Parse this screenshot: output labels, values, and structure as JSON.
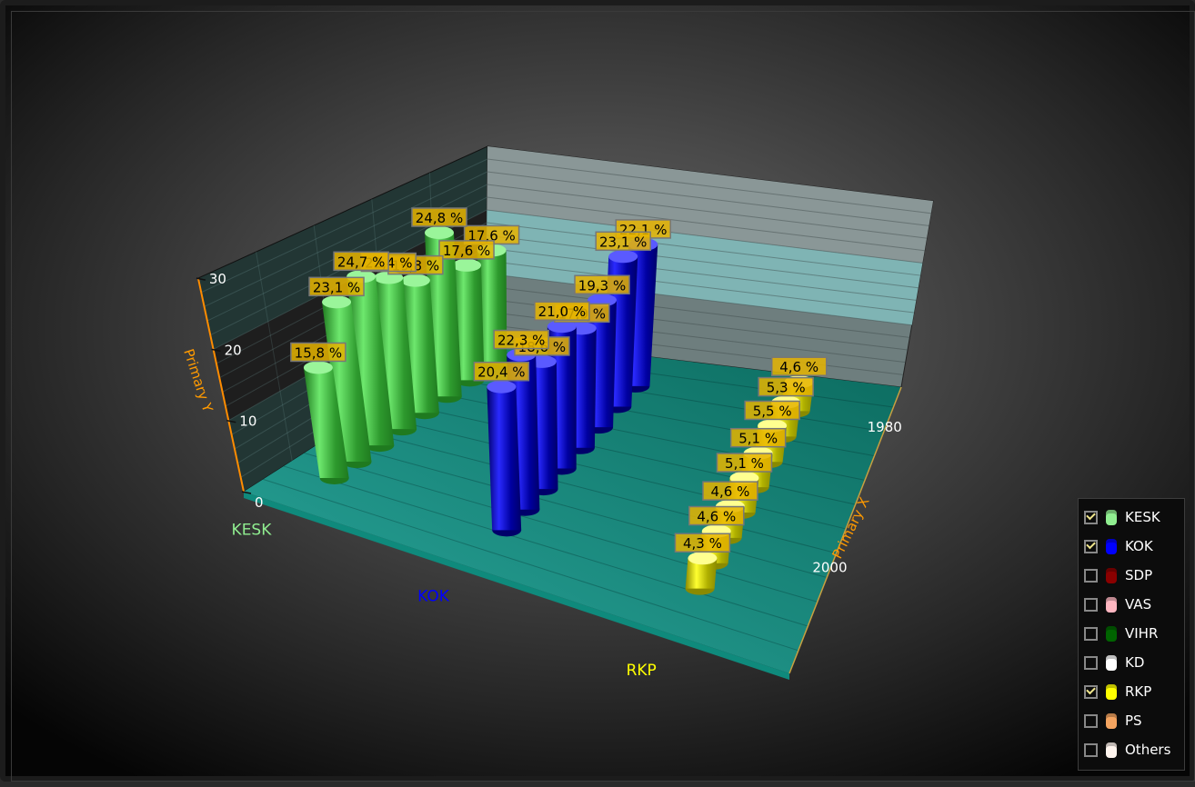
{
  "chart_data": {
    "type": "bar3d",
    "categories": [
      "KESK",
      "KOK",
      "RKP"
    ],
    "x": [
      1983,
      1987,
      1991,
      1995,
      1999,
      2003,
      2007,
      2011
    ],
    "series": [
      {
        "name": "KESK",
        "color": "#4fd04f",
        "values": [
          17.6,
          17.6,
          24.8,
          19.8,
          22.4,
          24.7,
          23.1,
          15.8
        ]
      },
      {
        "name": "KOK",
        "color": "#0a0ae0",
        "values": [
          22.1,
          23.1,
          19.3,
          17.9,
          21.0,
          18.6,
          22.3,
          20.4
        ]
      },
      {
        "name": "RKP",
        "color": "#e8e800",
        "values": [
          4.6,
          5.3,
          5.5,
          5.1,
          5.1,
          4.6,
          4.6,
          4.3
        ]
      }
    ],
    "data_label_suffix": " %",
    "xlabel": "Primary X",
    "ylabel": "Primary Y",
    "ylim": [
      0,
      30
    ],
    "yticks": [
      "0",
      "10",
      "20",
      "30"
    ],
    "xticks": [
      {
        "value": 1980,
        "label": "1980"
      },
      {
        "value": 2000,
        "label": "2000"
      }
    ],
    "grid": true,
    "legend_position": "bottom-right"
  },
  "legend": [
    {
      "label": "KESK",
      "checked": true,
      "color": "#90ee90"
    },
    {
      "label": "KOK",
      "checked": true,
      "color": "#0000ff"
    },
    {
      "label": "SDP",
      "checked": false,
      "color": "#8b0000"
    },
    {
      "label": "VAS",
      "checked": false,
      "color": "#ffb6c1"
    },
    {
      "label": "VIHR",
      "checked": false,
      "color": "#006400"
    },
    {
      "label": "KD",
      "checked": false,
      "color": "#ffffff"
    },
    {
      "label": "RKP",
      "checked": true,
      "color": "#ffff00"
    },
    {
      "label": "PS",
      "checked": false,
      "color": "#f4a460"
    },
    {
      "label": "Others",
      "checked": false,
      "color": "#fff5ee"
    }
  ]
}
